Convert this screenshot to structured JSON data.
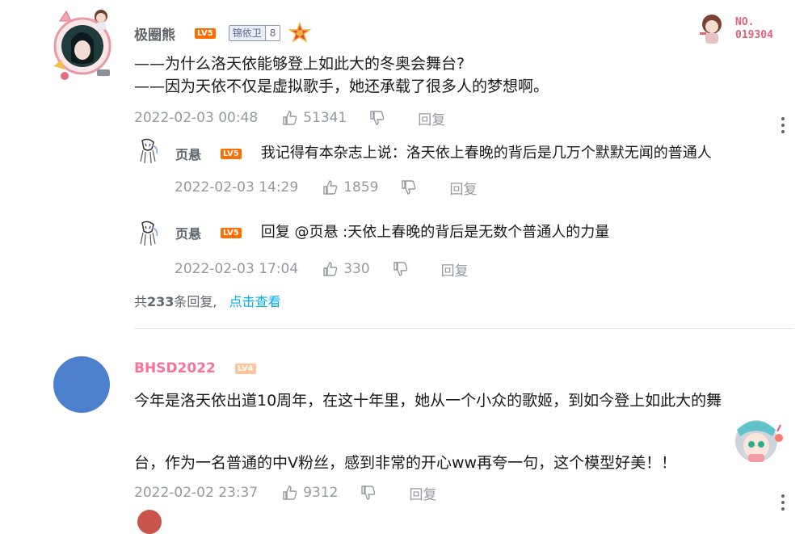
{
  "colors": {
    "accent": "#00aeec",
    "vip_pink": "#fb7299",
    "level5": "#ff6c00",
    "level4": "#ffc49a",
    "meta": "#9499a0"
  },
  "comments": [
    {
      "user": "极圈熊",
      "level": "LV5",
      "medal": {
        "name": "锦依卫",
        "level": "8"
      },
      "badge_no": "NO.",
      "badge_num": "019304",
      "lines": [
        "——为什么洛天依能够登上如此大的冬奥会舞台?",
        "——因为天依不仅是虚拟歌手，她还承载了很多人的梦想啊。"
      ],
      "date": "2022-02-03 00:48",
      "likes": "51341",
      "reply_label": "回复",
      "replies": [
        {
          "user": "页悬",
          "level": "LV5",
          "text": "我记得有本杂志上说：洛天依上春晚的背后是几万个默默无闻的普通人",
          "date": "2022-02-03 14:29",
          "likes": "1859",
          "reply_label": "回复"
        },
        {
          "user": "页悬",
          "level": "LV5",
          "text": "回复 @页悬 :天依上春晚的背后是无数个普通人的力量",
          "date": "2022-02-03 17:04",
          "likes": "330",
          "reply_label": "回复"
        }
      ],
      "more": {
        "prefix": "共",
        "count": "233",
        "suffix": "条回复,",
        "link": "点击查看"
      }
    },
    {
      "user": "BHSD2022",
      "level": "LV4",
      "lines": [
        "今年是洛天依出道10周年，在这十年里，她从一个小众的歌姬，到如今登上如此大的舞",
        "台，作为一名普通的中V粉丝，感到非常的开心ww再夸一句，这个模型好美！！"
      ],
      "date": "2022-02-02 23:37",
      "likes": "9312",
      "reply_label": "回复"
    }
  ]
}
